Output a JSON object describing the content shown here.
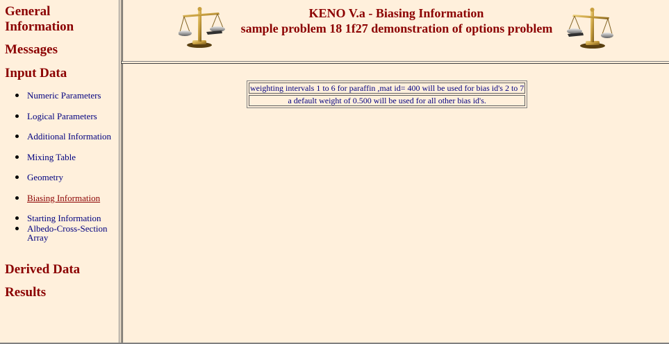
{
  "nav": {
    "general": "General Information",
    "messages": "Messages",
    "input_data": "Input Data",
    "input_items": [
      {
        "label": "Numeric Parameters",
        "active": false
      },
      {
        "label": "Logical Parameters",
        "active": false
      },
      {
        "label": "Additional Information",
        "active": false
      },
      {
        "label": "Mixing Table",
        "active": false
      },
      {
        "label": "Geometry",
        "active": false
      },
      {
        "label": "Biasing Information",
        "active": true
      },
      {
        "label": "Starting Information",
        "active": false
      },
      {
        "label": "Albedo-Cross-Section Array",
        "active": false
      }
    ],
    "derived_data": "Derived Data",
    "results": "Results"
  },
  "header": {
    "title": "KENO V.a - Biasing Information",
    "subtitle": "sample problem 18 1f27 demonstration of options problem",
    "icon": "balance-scale-icon"
  },
  "bias_table": {
    "rows": [
      "weighting intervals 1 to 6 for paraffin ,mat id= 400 will be used for bias id's 2 to 7",
      "a default weight of 0.500 will be used for all other bias id's."
    ]
  },
  "colors": {
    "background": "#fff0dc",
    "heading": "#8b0000",
    "link": "#000080"
  }
}
